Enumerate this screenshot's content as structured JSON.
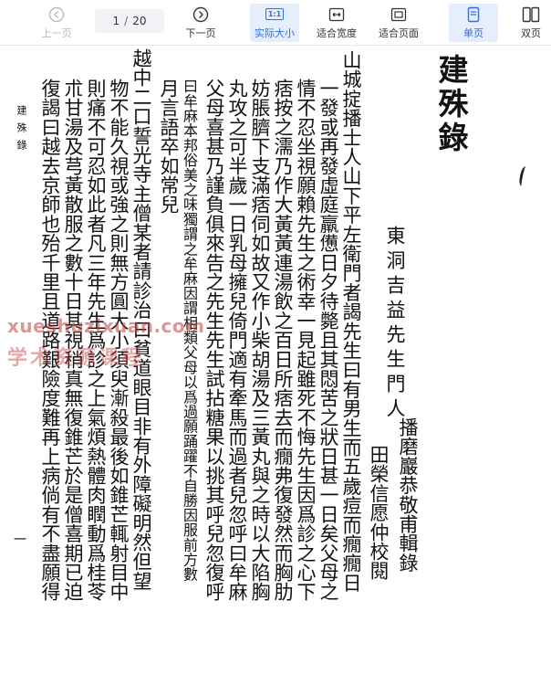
{
  "toolbar": {
    "prev": {
      "label": "上一页",
      "icon": "chevron-left-circle-icon"
    },
    "page_current": "1",
    "page_sep": "/",
    "page_total": "20",
    "next": {
      "label": "下一页",
      "icon": "chevron-right-circle-icon"
    },
    "actual_size": {
      "label": "实际大小",
      "icon_text": "1:1"
    },
    "fit_width": {
      "label": "适合宽度",
      "icon": "fit-width-icon"
    },
    "fit_page": {
      "label": "适合页面",
      "icon": "fit-page-icon"
    },
    "single_page": {
      "label": "单页",
      "icon": "single-page-icon"
    },
    "double_page": {
      "label": "双页",
      "icon": "double-page-icon"
    },
    "accent_color": "#2a6fe5"
  },
  "document": {
    "title": "建殊錄",
    "author": "東洞吉益先生門人",
    "recorder": "播磨巖恭敬甫輯錄",
    "editor": "田榮信愿仲校閱",
    "body_columns": [
      "山城掟播士人山下平左衛門者謁先生曰有男生而五歲痘而癇癇日",
      "一發或再發虛庭羸憊日夕待斃且其悶苦之狀日甚一日矣父母之",
      "情不忍坐視願賴先生之術幸一見起雖死不悔先生因爲診之心下",
      "痞按之濡乃作大黃黃連湯飲之百日所痞去而癇弗復發然而胸肋",
      "妨脹臍下支滿痞伺如故又作小柴胡湯及三黃丸與之時以大陷胸",
      "丸攻之可半歲一日乳母擁兒倚門適有牽馬而過者兒忽呼曰牟麻",
      "父母喜甚乃謹負俱來告之先生先生試拈糖果以挑其呼兒忽復呼",
      "曰牟麻本邦俗美之味獨謂之牟麻因謂相類父母以爲過願踊躍不自勝因服前方數",
      "月言語卒如常兒",
      "越中二口誓光寺主僧某者請診治曰貧道眼目非有外障礙明然但望",
      "物不能久視或強之則無方圓大小須臾漸殺最後如錐芒輒射目中",
      "則痛不可忍如此者凡三年先生爲診之上氣煩熱體肉瞤動爲桂苓",
      "朮甘湯及芎黃散服之數十日其視稍真無復錐芒於是僧喜期已迫",
      "復謁曰越去京師也殆千里且道路艱險度難再上病倘有不盡願得"
    ],
    "margin_label": "建殊錄",
    "page_number": "一"
  },
  "watermark": {
    "url": "xueshuzixuan.com",
    "text": "学术资源课程"
  }
}
